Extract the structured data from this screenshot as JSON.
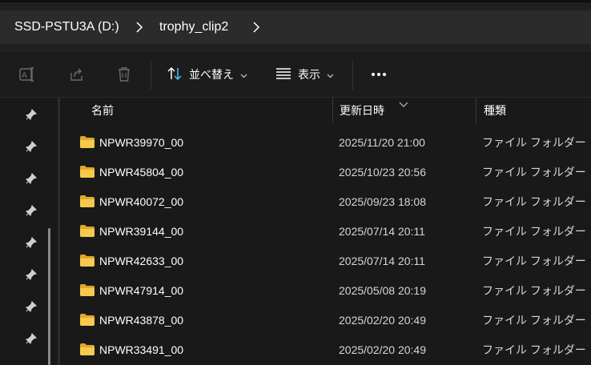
{
  "breadcrumb": {
    "items": [
      {
        "label": "SSD-PSTU3A (D:)"
      },
      {
        "label": "trophy_clip2"
      }
    ]
  },
  "toolbar": {
    "rename_icon": "rename-icon",
    "share_icon": "share-icon",
    "delete_icon": "trash-icon",
    "sort_label": "並べ替え",
    "view_label": "表示",
    "more_icon": "more-icon"
  },
  "navigation": {
    "pinned_count_icon": "pin-icon"
  },
  "columns": {
    "name": "名前",
    "modified": "更新日時",
    "type": "種類"
  },
  "files": [
    {
      "name": "NPWR39970_00",
      "modified": "2025/11/20 21:00",
      "type": "ファイル フォルダー"
    },
    {
      "name": "NPWR45804_00",
      "modified": "2025/10/23 20:56",
      "type": "ファイル フォルダー"
    },
    {
      "name": "NPWR40072_00",
      "modified": "2025/09/23 18:08",
      "type": "ファイル フォルダー"
    },
    {
      "name": "NPWR39144_00",
      "modified": "2025/07/14 20:11",
      "type": "ファイル フォルダー"
    },
    {
      "name": "NPWR42633_00",
      "modified": "2025/07/14 20:11",
      "type": "ファイル フォルダー"
    },
    {
      "name": "NPWR47914_00",
      "modified": "2025/05/08 20:19",
      "type": "ファイル フォルダー"
    },
    {
      "name": "NPWR43878_00",
      "modified": "2025/02/20 20:49",
      "type": "ファイル フォルダー"
    },
    {
      "name": "NPWR33491_00",
      "modified": "2025/02/20 20:49",
      "type": "ファイル フォルダー"
    }
  ],
  "colors": {
    "folder": "#f8c94b",
    "folder_dark": "#e0a82a",
    "background": "#191919"
  }
}
